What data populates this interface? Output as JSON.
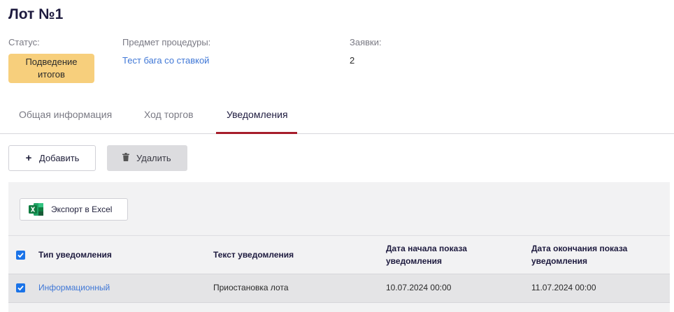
{
  "page": {
    "title": "Лот №1"
  },
  "info": {
    "status_label": "Статус:",
    "status_value_line1": "Подведение",
    "status_value_line2": "итогов",
    "subject_label": "Предмет процедуры:",
    "subject_value": "Тест бага со ставкой",
    "bids_label": "Заявки:",
    "bids_value": "2"
  },
  "tabs": [
    {
      "label": "Общая информация",
      "active": false
    },
    {
      "label": "Ход торгов",
      "active": false
    },
    {
      "label": "Уведомления",
      "active": true
    }
  ],
  "toolbar": {
    "add_label": "Добавить",
    "add_icon": "plus-icon",
    "delete_label": "Удалить",
    "delete_icon": "trash-icon"
  },
  "grid": {
    "export_label": "Экспорт в Excel",
    "export_icon": "excel-icon",
    "columns": [
      {
        "line1": "Тип уведомления",
        "line2": ""
      },
      {
        "line1": "Текст уведомления",
        "line2": ""
      },
      {
        "line1": "Дата начала показа",
        "line2": "уведомления"
      },
      {
        "line1": "Дата окончания показа",
        "line2": "уведомления"
      }
    ],
    "rows": [
      {
        "checked": true,
        "type": "Информационный",
        "text": "Приостановка лота",
        "start": "10.07.2024 00:00",
        "end": "11.07.2024 00:00"
      }
    ],
    "header_checked": true
  },
  "colors": {
    "accent": "#a61d2b",
    "status_badge": "#f7cf7c",
    "link": "#3f77d6",
    "checkbox": "#1a73e8"
  }
}
